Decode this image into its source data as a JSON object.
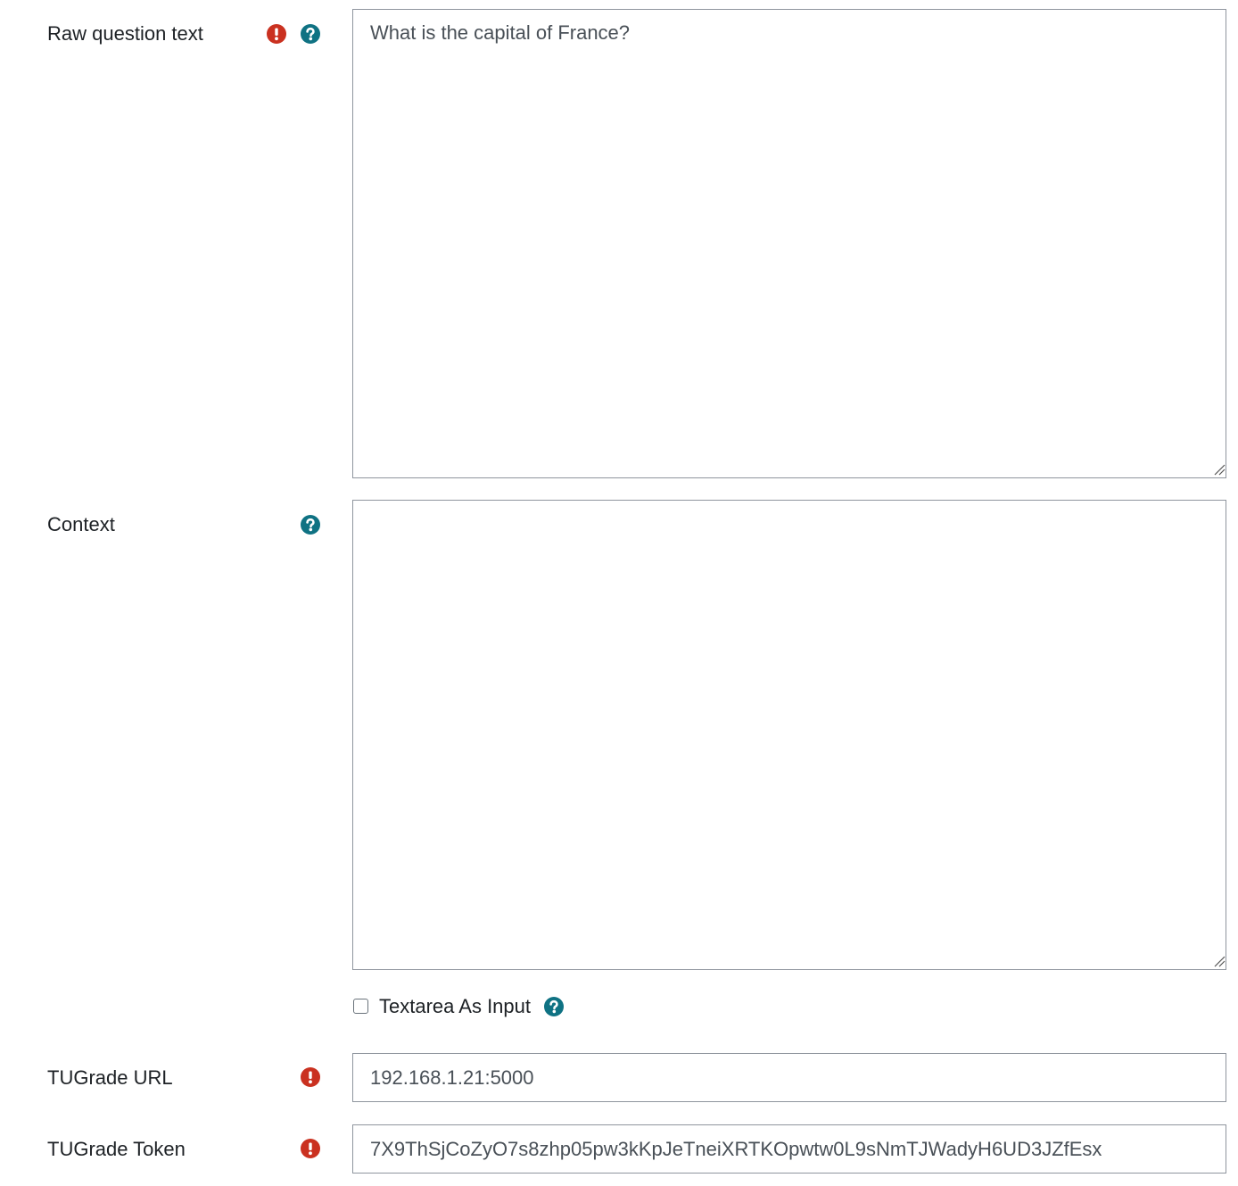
{
  "raw_question": {
    "label": "Raw question text",
    "required_icon": "exclamation-circle-icon",
    "help_icon": "question-circle-icon",
    "value": "What is the capital of France?"
  },
  "context": {
    "label": "Context",
    "help_icon": "question-circle-icon",
    "value": ""
  },
  "textarea_as_input": {
    "label": "Textarea As Input",
    "checked": false,
    "help_icon": "question-circle-icon"
  },
  "tugrade_url": {
    "label": "TUGrade URL",
    "required_icon": "exclamation-circle-icon",
    "value": "192.168.1.21:5000"
  },
  "tugrade_token": {
    "label": "TUGrade Token",
    "required_icon": "exclamation-circle-icon",
    "value": "7X9ThSjCoZyO7s8zhp05pw3kKpJeTneiXRTKOpwtw0L9sNmTJWadyH6UD3JZfEsx"
  },
  "colors": {
    "required": "#ca3120",
    "help": "#0f6cbf",
    "help_teal": "#0f7283",
    "border": "#8f959e"
  }
}
